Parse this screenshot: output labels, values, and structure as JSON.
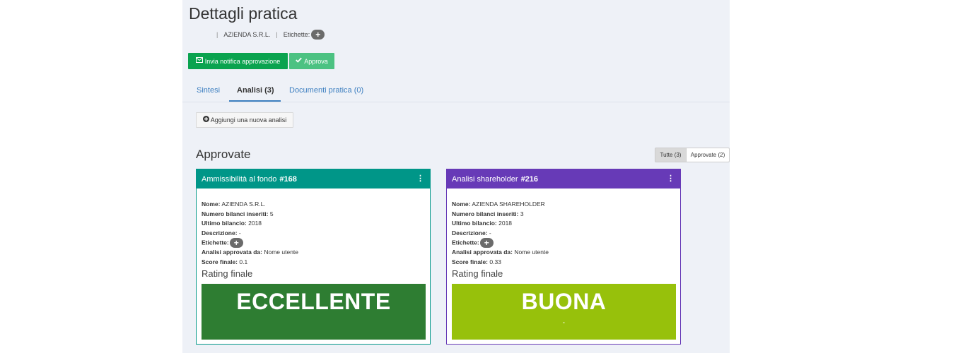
{
  "page": {
    "title": "Dettagli pratica",
    "company": "AZIENDA S.R.L.",
    "tags_label": "Etichette:",
    "plus": "+"
  },
  "actions": {
    "notify_label": "Invia notifica approvazione",
    "approve_label": "Approva"
  },
  "tabs": [
    {
      "label": "Sintesi"
    },
    {
      "label": "Analisi (3)"
    },
    {
      "label": "Documenti pratica (0)"
    }
  ],
  "add_analysis_label": "Aggiungi una nuova analisi",
  "section": {
    "title": "Approvate",
    "filters": [
      {
        "label": "Tutte (3)"
      },
      {
        "label": "Approvate (2)"
      }
    ]
  },
  "cards": [
    {
      "title": "Ammissibilità al fondo",
      "number": "#168",
      "kebab": "⋮",
      "fields": [
        {
          "label": "Nome:",
          "value": "AZIENDA S.R.L."
        },
        {
          "label": "Numero bilanci inseriti:",
          "value": "5"
        },
        {
          "label": "Ultimo bilancio:",
          "value": "2018"
        },
        {
          "label": "Descrizione:",
          "value": "-"
        },
        {
          "label": "Etichette:",
          "value": "+"
        },
        {
          "label": "Analisi approvata da:",
          "value": "Nome utente"
        },
        {
          "label": "Score finale:",
          "value": "0.1"
        }
      ],
      "rating_label": "Rating finale",
      "rating": "ECCELLENTE",
      "rating_sub": "",
      "color": "#009688",
      "rating_color": "#2e7d32"
    },
    {
      "title": "Analisi shareholder",
      "number": "#216",
      "kebab": "⋮",
      "fields": [
        {
          "label": "Nome:",
          "value": "AZIENDA SHAREHOLDER"
        },
        {
          "label": "Numero bilanci inseriti:",
          "value": "3"
        },
        {
          "label": "Ultimo bilancio:",
          "value": "2018"
        },
        {
          "label": "Descrizione:",
          "value": "-"
        },
        {
          "label": "Etichette:",
          "value": "+"
        },
        {
          "label": "Analisi approvata da:",
          "value": "Nome utente"
        },
        {
          "label": "Score finale:",
          "value": "0.33"
        }
      ],
      "rating_label": "Rating finale",
      "rating": "BUONA",
      "rating_sub": "-",
      "color": "#673ab7",
      "rating_color": "#97c10b"
    }
  ],
  "icons": {
    "envelope": "envelope-icon",
    "check": "check-icon",
    "plus_circle": "plus-circle-icon",
    "kebab": "kebab-menu-icon"
  }
}
